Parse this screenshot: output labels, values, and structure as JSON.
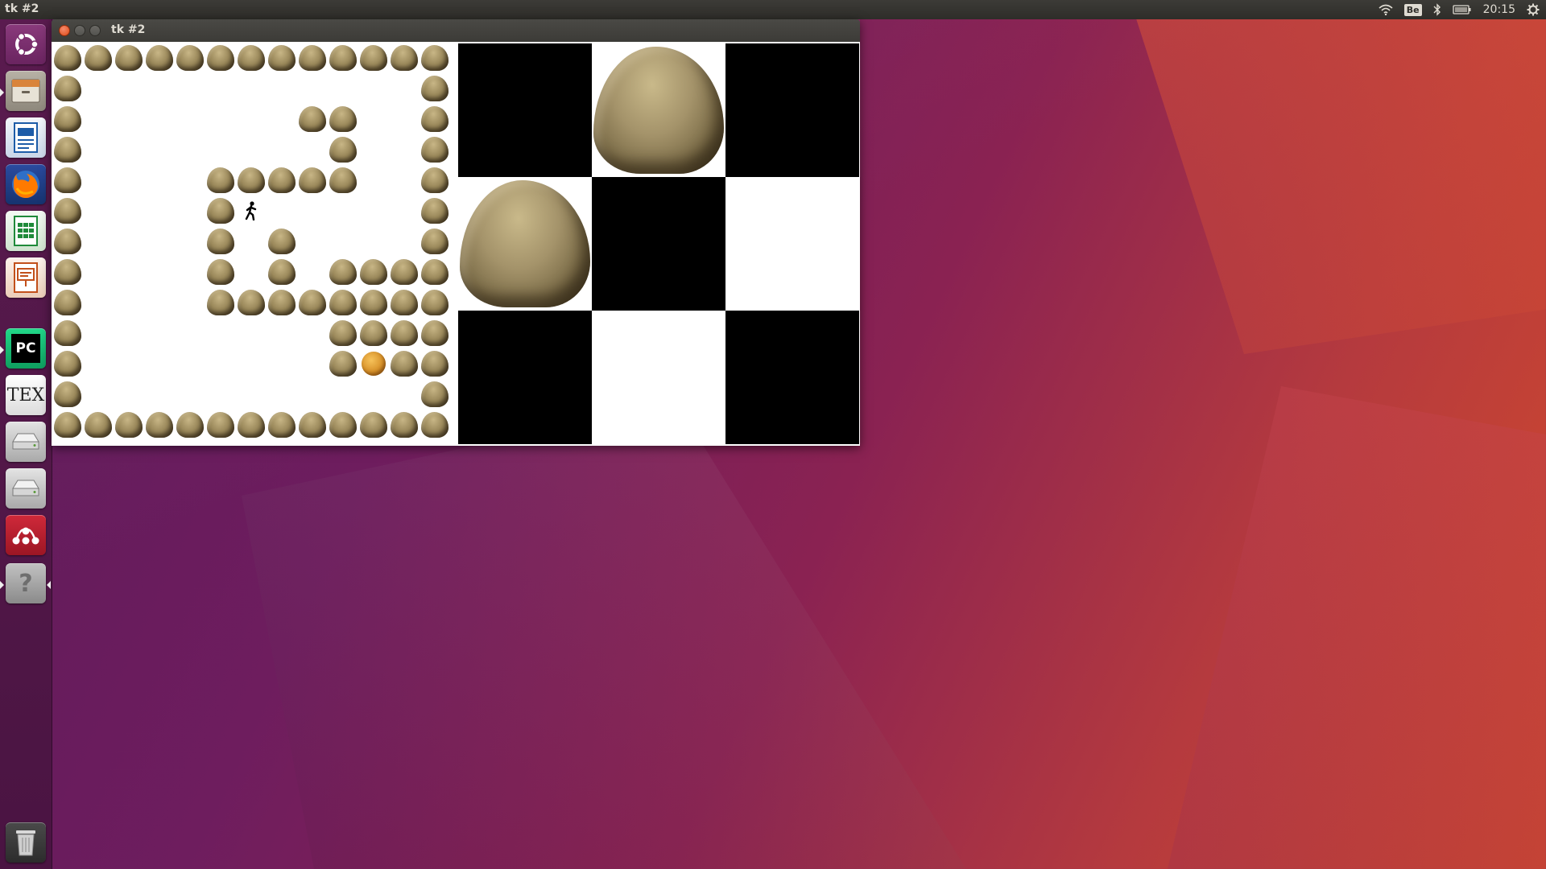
{
  "top_panel": {
    "app_title": "tk #2",
    "keyboard_layout": "Be",
    "clock": "20:15"
  },
  "launcher": {
    "items": [
      {
        "name": "ubuntu-dash-icon",
        "color": "#dd4814"
      },
      {
        "name": "files-icon",
        "color": "#c9a36a"
      },
      {
        "name": "writer-icon",
        "color": "#1d5ca8"
      },
      {
        "name": "firefox-icon",
        "color": "#e66000"
      },
      {
        "name": "calc-icon",
        "color": "#1f8a3a"
      },
      {
        "name": "impress-icon",
        "color": "#c2501b"
      },
      {
        "name": "pycharm-icon",
        "color": "#21d789"
      },
      {
        "name": "tex-icon",
        "color": "#ffffff"
      },
      {
        "name": "drive-icon",
        "color": "#cfcfcf"
      },
      {
        "name": "drive2-icon",
        "color": "#cfcfcf"
      },
      {
        "name": "mendeley-icon",
        "color": "#b51f2e"
      },
      {
        "name": "help-icon",
        "color": "#9a9a9a"
      },
      {
        "name": "trash-icon",
        "color": "#d0d0d0"
      }
    ],
    "tex_label": "TEX",
    "help_label": "?",
    "pycharm_label": "PC"
  },
  "window": {
    "title": "tk #2"
  },
  "game": {
    "rows": 13,
    "cols": 13,
    "map": [
      "#############",
      "#...........#",
      "#.......##..#",
      "#........#..#",
      "#....#####..#",
      "#....#@.....#",
      "#....#.#....#",
      "#....#.#.####",
      "#....########",
      "#........####",
      "#........#B##",
      "#...........#",
      "#############"
    ],
    "player_symbol": "🚶"
  },
  "preview": {
    "rows": 3,
    "cols": 3,
    "cells": [
      "black",
      "rock",
      "black",
      "rock",
      "black",
      "white",
      "black",
      "white",
      "black"
    ]
  }
}
